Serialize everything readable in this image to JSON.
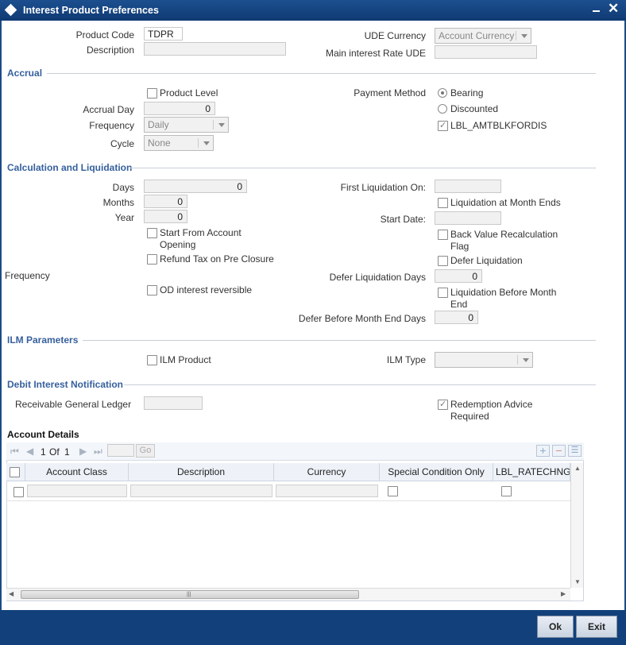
{
  "window": {
    "title": "Interest Product Preferences"
  },
  "header": {
    "product_code_label": "Product Code",
    "product_code_value": "TDPR",
    "description_label": "Description",
    "description_value": "",
    "ude_currency_label": "UDE Currency",
    "ude_currency_value": "Account Currency",
    "main_rate_label": "Main interest Rate UDE",
    "main_rate_value": ""
  },
  "accrual": {
    "section_title": "Accrual",
    "product_level_label": "Product Level",
    "product_level_checked": false,
    "accrual_day_label": "Accrual Day",
    "accrual_day_value": "0",
    "frequency_label": "Frequency",
    "frequency_value": "Daily",
    "cycle_label": "Cycle",
    "cycle_value": "None",
    "payment_method_label": "Payment Method",
    "bearing_label": "Bearing",
    "discounted_label": "Discounted",
    "payment_method_selected": "Bearing",
    "amtblk_label": "LBL_AMTBLKFORDIS",
    "amtblk_checked": true
  },
  "calc": {
    "section_title": "Calculation and Liquidation",
    "days_label": "Days",
    "days_value": "0",
    "months_label": "Months",
    "months_value": "0",
    "year_label": "Year",
    "year_value": "0",
    "start_from_account_label": "Start From Account",
    "start_from_account_label2": "Opening",
    "refund_tax_label": "Refund Tax on Pre Closure",
    "frequency_label": "Frequency",
    "od_reversible_label": "OD interest reversible",
    "first_liq_label": "First Liquidation On:",
    "first_liq_value": "",
    "liq_month_ends_label": "Liquidation at Month Ends",
    "start_date_label": "Start Date:",
    "start_date_value": "",
    "back_value_label": "Back Value Recalculation",
    "back_value_label2": "Flag",
    "defer_liq_label": "Defer Liquidation",
    "defer_liq_days_label": "Defer Liquidation Days",
    "defer_liq_days_value": "0",
    "liq_before_month_label": "Liquidation Before Month",
    "liq_before_month_label2": "End",
    "defer_before_month_label": "Defer Before Month End Days",
    "defer_before_month_value": "0"
  },
  "ilm": {
    "section_title": "ILM Parameters",
    "ilm_product_label": "ILM Product",
    "ilm_type_label": "ILM Type",
    "ilm_type_value": ""
  },
  "debit": {
    "section_title": "Debit Interest Notification",
    "receivable_gl_label": "Receivable General Ledger",
    "receivable_gl_value": "",
    "redemption_label": "Redemption Advice",
    "redemption_label2": "Required",
    "redemption_checked": true
  },
  "account_details": {
    "title": "Account Details",
    "pager_current": "1",
    "pager_of": "Of",
    "pager_total": "1",
    "go_label": "Go",
    "columns": [
      "Account Class",
      "Description",
      "Currency",
      "Special Condition Only",
      "LBL_RATECHNG"
    ]
  },
  "footer": {
    "ok_label": "Ok",
    "exit_label": "Exit"
  }
}
